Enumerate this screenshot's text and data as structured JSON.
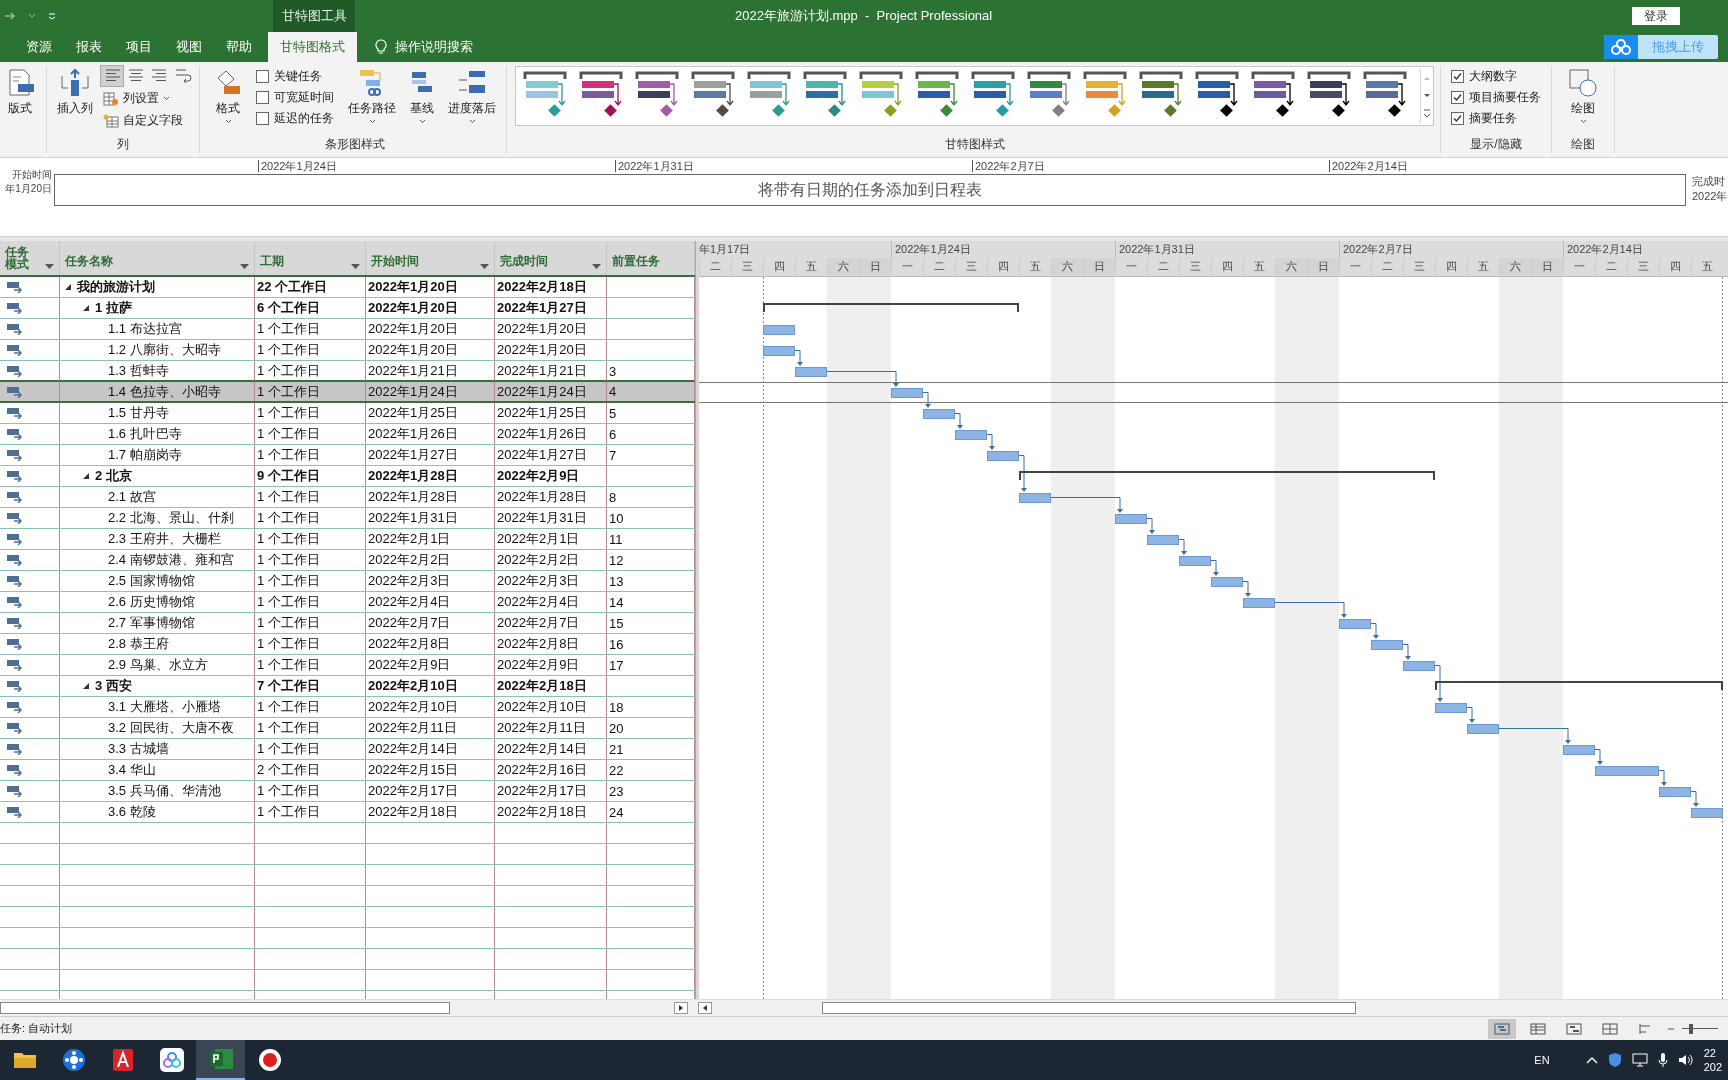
{
  "title_bar": {
    "contextual_tab": "甘特图工具",
    "title": "2022年旅游计划.mpp  -  Project Professional",
    "login": "登录",
    "upload": "拖拽上传"
  },
  "tabs": [
    {
      "label": "资源",
      "selected": false
    },
    {
      "label": "报表",
      "selected": false
    },
    {
      "label": "项目",
      "selected": false
    },
    {
      "label": "视图",
      "selected": false
    },
    {
      "label": "帮助",
      "selected": false
    },
    {
      "label": "甘特图格式",
      "selected": true
    }
  ],
  "tell_me": "操作说明搜索",
  "ribbon": {
    "layout_button": "版式",
    "columns_group": {
      "label": "列",
      "insert_column": "插入列",
      "align_buttons": [
        {
          "selected": true
        },
        {
          "selected": false
        },
        {
          "selected": false
        }
      ],
      "column_settings": "列设置",
      "custom_fields": "自定义字段"
    },
    "bar_styles_group": {
      "label": "条形图样式",
      "format": "格式",
      "checkboxes": [
        {
          "label": "关键任务",
          "checked": false
        },
        {
          "label": "可宽延时间",
          "checked": false
        },
        {
          "label": "延迟的任务",
          "checked": false
        }
      ],
      "task_path": "任务路径",
      "baseline": "基线",
      "slippage": "进度落后"
    },
    "gantt_styles_group": {
      "label": "甘特图样式",
      "styles": [
        {
          "top": {
            "color": "#7fcbd6"
          },
          "bottom": {
            "color": "#9cc3e6"
          },
          "milestone": {
            "color": "#2e9a9a"
          }
        },
        {
          "top": {
            "color": "#d2307f"
          },
          "bottom": {
            "color": "#7b5b9e"
          },
          "milestone": {
            "color": "#a0105a"
          }
        },
        {
          "top": {
            "color": "#a15ea8"
          },
          "bottom": {
            "color": "#3d3d5c"
          },
          "milestone": {
            "color": "#a05aa8"
          }
        },
        {
          "top": {
            "color": "#9e9e9e"
          },
          "bottom": {
            "color": "#5b7aa8"
          },
          "milestone": {
            "color": "#4d4d4d"
          }
        },
        {
          "top": {
            "color": "#7ec6d6"
          },
          "bottom": {
            "color": "#9e9e9e"
          },
          "milestone": {
            "color": "#2e9a8e"
          }
        },
        {
          "top": {
            "color": "#4cb8a8"
          },
          "bottom": {
            "color": "#2e6ea6"
          },
          "milestone": {
            "color": "#2e8a7a"
          }
        },
        {
          "top": {
            "color": "#b6cf3c"
          },
          "bottom": {
            "color": "#7ec6d6"
          },
          "milestone": {
            "color": "#8aa020"
          }
        },
        {
          "top": {
            "color": "#6ab84a"
          },
          "bottom": {
            "color": "#2a5ea8"
          },
          "milestone": {
            "color": "#3a8a3a"
          }
        },
        {
          "top": {
            "color": "#2aa0a8"
          },
          "bottom": {
            "color": "#2a5ea8"
          },
          "milestone": {
            "color": "#2a9aa0"
          }
        },
        {
          "top": {
            "color": "#2e8a3e"
          },
          "bottom": {
            "color": "#5a7ec8"
          },
          "milestone": {
            "color": "#808080"
          }
        },
        {
          "top": {
            "color": "#e8b030"
          },
          "bottom": {
            "color": "#e88a40"
          },
          "milestone": {
            "color": "#d4a020"
          }
        },
        {
          "top": {
            "color": "#5a7a2a"
          },
          "bottom": {
            "color": "#2a6a8a"
          },
          "milestone": {
            "color": "#5a7a2a"
          }
        },
        {
          "top": {
            "color": "#2a5ea8"
          },
          "bottom": {
            "color": "#2a5ea8"
          },
          "milestone": {
            "color": "#000000"
          }
        },
        {
          "top": {
            "color": "#7a5aa8"
          },
          "bottom": {
            "color": "#6a5aa0"
          },
          "milestone": {
            "color": "#000000"
          }
        },
        {
          "top": {
            "color": "#3d3d5c"
          },
          "bottom": {
            "color": "#4a4a6a"
          },
          "milestone": {
            "color": "#000000"
          }
        },
        {
          "top": {
            "color": "#5a7aa8"
          },
          "bottom": {
            "color": "#5a6a98"
          },
          "milestone": {
            "color": "#000000"
          }
        }
      ]
    },
    "show_hide_group": {
      "label": "显示/隐藏",
      "checkboxes": [
        {
          "label": "大纲数字",
          "checked": true
        },
        {
          "label": "项目摘要任务",
          "checked": true
        },
        {
          "label": "摘要任务",
          "checked": true
        }
      ]
    },
    "drawing_group": {
      "label": "绘图",
      "button": "绘图"
    }
  },
  "timeline": {
    "start_label": "开始时间",
    "start_date": "年1月20日",
    "ticks": [
      "2022年1月24日",
      "2022年1月31日",
      "2022年2月7日",
      "2022年2月14日"
    ],
    "placeholder": "将带有日期的任务添加到日程表",
    "finish_label": "完成时",
    "finish_date": "2022年"
  },
  "table": {
    "columns": [
      "任务模式",
      "任务名称",
      "工期",
      "开始时间",
      "完成时间",
      "前置任务"
    ],
    "rows": [
      {
        "name": "我的旅游计划",
        "duration": "22 个工作日",
        "start": "2022年1月20日",
        "finish": "2022年2月18日",
        "kind": "project",
        "expanded": true,
        "selected": false,
        "children": [
          {
            "name": "1 拉萨",
            "duration": "6 个工作日",
            "start": "2022年1月20日",
            "finish": "2022年1月27日",
            "kind": "summary",
            "expanded": true,
            "selected": false,
            "children": [
              {
                "name": "1.1 布达拉宫",
                "duration": "1 个工作日",
                "start": "2022年1月20日",
                "finish": "2022年1月20日",
                "kind": "task",
                "selected": false
              },
              {
                "name": "1.2 八廓街、大昭寺",
                "duration": "1 个工作日",
                "start": "2022年1月20日",
                "finish": "2022年1月20日",
                "kind": "task",
                "selected": false
              },
              {
                "name": "1.3 哲蚌寺",
                "duration": "1 个工作日",
                "start": "2022年1月21日",
                "finish": "2022年1月21日",
                "predecessors": "3",
                "kind": "task",
                "selected": false
              },
              {
                "name": "1.4 色拉寺、小昭寺",
                "duration": "1 个工作日",
                "start": "2022年1月24日",
                "finish": "2022年1月24日",
                "predecessors": "4",
                "kind": "task",
                "selected": true
              },
              {
                "name": "1.5 甘丹寺",
                "duration": "1 个工作日",
                "start": "2022年1月25日",
                "finish": "2022年1月25日",
                "predecessors": "5",
                "kind": "task",
                "selected": false
              },
              {
                "name": "1.6 扎叶巴寺",
                "duration": "1 个工作日",
                "start": "2022年1月26日",
                "finish": "2022年1月26日",
                "predecessors": "6",
                "kind": "task",
                "selected": false
              },
              {
                "name": "1.7 帕崩岗寺",
                "duration": "1 个工作日",
                "start": "2022年1月27日",
                "finish": "2022年1月27日",
                "predecessors": "7",
                "kind": "task",
                "selected": false
              }
            ]
          },
          {
            "name": "2 北京",
            "duration": "9 个工作日",
            "start": "2022年1月28日",
            "finish": "2022年2月9日",
            "kind": "summary",
            "expanded": true,
            "selected": false,
            "children": [
              {
                "name": "2.1 故宫",
                "duration": "1 个工作日",
                "start": "2022年1月28日",
                "finish": "2022年1月28日",
                "predecessors": "8",
                "kind": "task",
                "selected": false
              },
              {
                "name": "2.2 北海、景山、什刹",
                "duration": "1 个工作日",
                "start": "2022年1月31日",
                "finish": "2022年1月31日",
                "predecessors": "10",
                "kind": "task",
                "selected": false
              },
              {
                "name": "2.3 王府井、大栅栏",
                "duration": "1 个工作日",
                "start": "2022年2月1日",
                "finish": "2022年2月1日",
                "predecessors": "11",
                "kind": "task",
                "selected": false
              },
              {
                "name": "2.4 南锣鼓港、雍和宫",
                "duration": "1 个工作日",
                "start": "2022年2月2日",
                "finish": "2022年2月2日",
                "predecessors": "12",
                "kind": "task",
                "selected": false
              },
              {
                "name": "2.5 国家博物馆",
                "duration": "1 个工作日",
                "start": "2022年2月3日",
                "finish": "2022年2月3日",
                "predecessors": "13",
                "kind": "task",
                "selected": false
              },
              {
                "name": "2.6 历史博物馆",
                "duration": "1 个工作日",
                "start": "2022年2月4日",
                "finish": "2022年2月4日",
                "predecessors": "14",
                "kind": "task",
                "selected": false
              },
              {
                "name": "2.7 军事博物馆",
                "duration": "1 个工作日",
                "start": "2022年2月7日",
                "finish": "2022年2月7日",
                "predecessors": "15",
                "kind": "task",
                "selected": false
              },
              {
                "name": "2.8 恭王府",
                "duration": "1 个工作日",
                "start": "2022年2月8日",
                "finish": "2022年2月8日",
                "predecessors": "16",
                "kind": "task",
                "selected": false
              },
              {
                "name": "2.9 鸟巢、水立方",
                "duration": "1 个工作日",
                "start": "2022年2月9日",
                "finish": "2022年2月9日",
                "predecessors": "17",
                "kind": "task",
                "selected": false
              }
            ]
          },
          {
            "name": "3 西安",
            "duration": "7 个工作日",
            "start": "2022年2月10日",
            "finish": "2022年2月18日",
            "kind": "summary",
            "expanded": true,
            "selected": false,
            "children": [
              {
                "name": "3.1 大雁塔、小雁塔",
                "duration": "1 个工作日",
                "start": "2022年2月10日",
                "finish": "2022年2月10日",
                "predecessors": "18",
                "kind": "task",
                "selected": false
              },
              {
                "name": "3.2 回民街、大唐不夜",
                "duration": "1 个工作日",
                "start": "2022年2月11日",
                "finish": "2022年2月11日",
                "predecessors": "20",
                "kind": "task",
                "selected": false
              },
              {
                "name": "3.3 古城墙",
                "duration": "1 个工作日",
                "start": "2022年2月14日",
                "finish": "2022年2月14日",
                "predecessors": "21",
                "kind": "task",
                "selected": false
              },
              {
                "name": "3.4 华山",
                "duration": "2 个工作日",
                "start": "2022年2月15日",
                "finish": "2022年2月16日",
                "predecessors": "22",
                "kind": "task",
                "selected": false
              },
              {
                "name": "3.5 兵马俑、华清池",
                "duration": "1 个工作日",
                "start": "2022年2月17日",
                "finish": "2022年2月17日",
                "predecessors": "23",
                "kind": "task",
                "selected": false
              },
              {
                "name": "3.6 乾陵",
                "duration": "1 个工作日",
                "start": "2022年2月18日",
                "finish": "2022年2月18日",
                "predecessors": "24",
                "kind": "task",
                "selected": false
              }
            ]
          }
        ]
      }
    ]
  },
  "gantt": {
    "weeks": [
      "年1月17日",
      "2022年1月24日",
      "2022年1月31日",
      "2022年2月7日",
      "2022年2月14日"
    ],
    "days": [
      {
        "label": "二",
        "weekend": false
      },
      {
        "label": "三",
        "weekend": false
      },
      {
        "label": "四",
        "weekend": false
      },
      {
        "label": "五",
        "weekend": false
      },
      {
        "label": "六",
        "weekend": true
      },
      {
        "label": "日",
        "weekend": true
      },
      {
        "label": "一",
        "weekend": false
      },
      {
        "label": "二",
        "weekend": false
      },
      {
        "label": "三",
        "weekend": false
      },
      {
        "label": "四",
        "weekend": false
      },
      {
        "label": "五",
        "weekend": false
      },
      {
        "label": "六",
        "weekend": true
      },
      {
        "label": "日",
        "weekend": true
      },
      {
        "label": "一",
        "weekend": false
      },
      {
        "label": "二",
        "weekend": false
      },
      {
        "label": "三",
        "weekend": false
      },
      {
        "label": "四",
        "weekend": false
      },
      {
        "label": "五",
        "weekend": false
      },
      {
        "label": "六",
        "weekend": true
      },
      {
        "label": "日",
        "weekend": true
      },
      {
        "label": "一",
        "weekend": false
      },
      {
        "label": "二",
        "weekend": false
      },
      {
        "label": "三",
        "weekend": false
      },
      {
        "label": "四",
        "weekend": false
      },
      {
        "label": "五",
        "weekend": false
      },
      {
        "label": "六",
        "weekend": true
      },
      {
        "label": "日",
        "weekend": true
      },
      {
        "label": "一",
        "weekend": false
      },
      {
        "label": "二",
        "weekend": false
      },
      {
        "label": "三",
        "weekend": false
      },
      {
        "label": "四",
        "weekend": false
      },
      {
        "label": "五",
        "weekend": false
      }
    ]
  },
  "status_bar": {
    "text": "任务: 自动计划",
    "views": [
      {
        "selected": true
      },
      {
        "selected": false
      },
      {
        "selected": false
      },
      {
        "selected": false
      },
      {
        "selected": false
      }
    ],
    "zoom": {
      "level": 0.25
    }
  },
  "taskbar": {
    "apps": [
      {
        "kind": "folder",
        "selected": false
      },
      {
        "kind": "flower",
        "selected": false
      },
      {
        "kind": "letter",
        "selected": false
      },
      {
        "kind": "cloud",
        "selected": false
      },
      {
        "kind": "project",
        "selected": true
      },
      {
        "kind": "record",
        "selected": false
      }
    ],
    "language": "EN",
    "clock_time": "22",
    "clock_date": "202"
  }
}
